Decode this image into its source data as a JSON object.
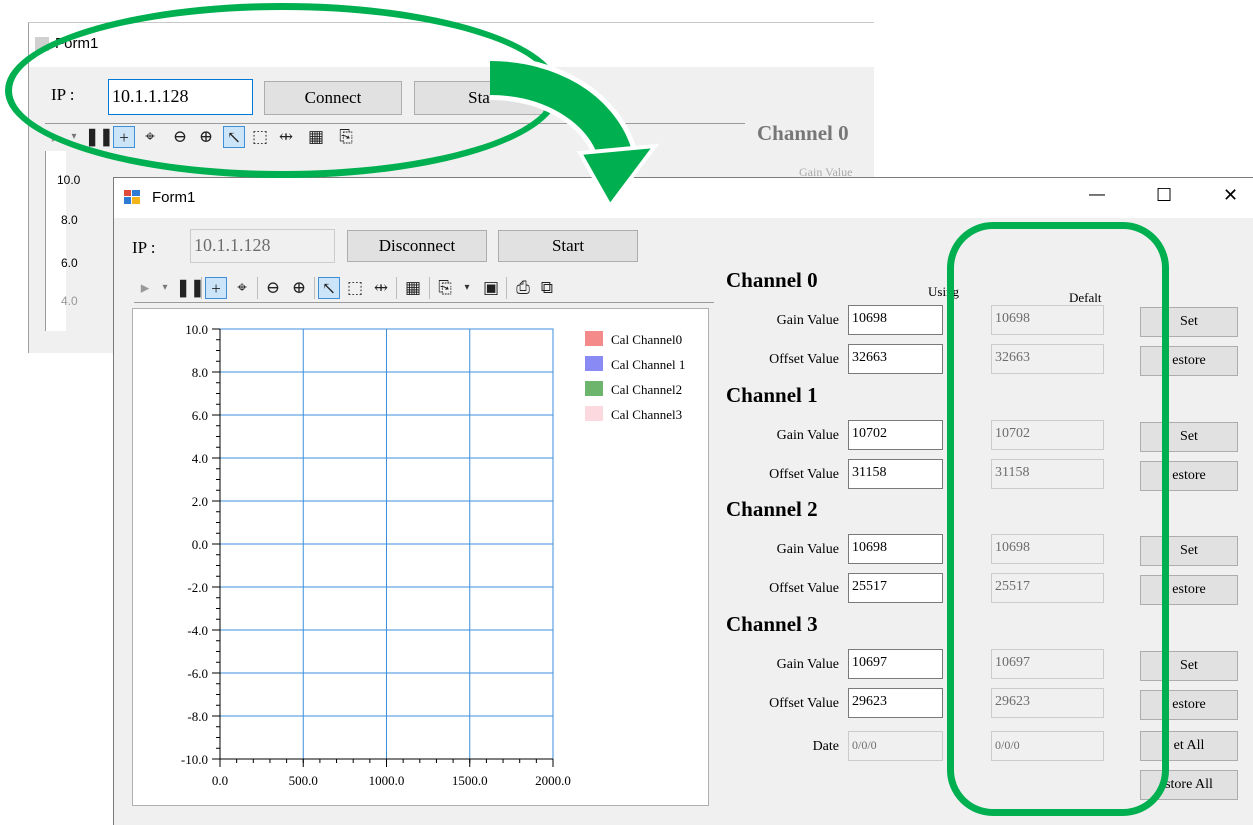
{
  "back_window": {
    "title": "Form1",
    "ip_label": "IP :",
    "ip_value": "10.1.1.128",
    "connect_label": "Connect",
    "start_label_partial": "Sta",
    "channel_title": "Channel 0",
    "gain_label_partial": "Gain Value",
    "y_ticks": [
      "10.0",
      "8.0",
      "6.0",
      "4.0"
    ]
  },
  "window": {
    "title": "Form1",
    "ip_label": "IP :",
    "ip_value": "10.1.1.128",
    "disconnect_label": "Disconnect",
    "start_label": "Start",
    "controls": {
      "minimize": "—",
      "maximize": "☐",
      "close": "✕"
    }
  },
  "chart_data": {
    "type": "line",
    "xlim": [
      0,
      2000
    ],
    "ylim": [
      -10,
      10
    ],
    "x_ticks": [
      "0.0",
      "500.0",
      "1000.0",
      "1500.0",
      "2000.0"
    ],
    "y_ticks": [
      "10.0",
      "8.0",
      "6.0",
      "4.0",
      "2.0",
      "0.0",
      "-2.0",
      "-4.0",
      "-6.0",
      "-8.0",
      "-10.0"
    ],
    "grid": true,
    "legend_position": "top-right",
    "series": [
      {
        "name": "Cal Channel0",
        "color": "#f48a8a",
        "values": []
      },
      {
        "name": "Cal Channel 1",
        "color": "#8a8af4",
        "values": []
      },
      {
        "name": "Cal Channel2",
        "color": "#6db56d",
        "values": []
      },
      {
        "name": "Cal Channel3",
        "color": "#fcd9df",
        "values": []
      }
    ]
  },
  "panel": {
    "using_header": "Using",
    "default_header": "Defalt",
    "channels": [
      {
        "title": "Channel 0",
        "gain_label": "Gain Value",
        "gain_using": "10698",
        "gain_default": "10698",
        "offset_label": "Offset Value",
        "offset_using": "32663",
        "offset_default": "32663",
        "set_label": "Set",
        "restore_label": "estore"
      },
      {
        "title": "Channel 1",
        "gain_label": "Gain Value",
        "gain_using": "10702",
        "gain_default": "10702",
        "offset_label": "Offset Value",
        "offset_using": "31158",
        "offset_default": "31158",
        "set_label": "Set",
        "restore_label": "estore"
      },
      {
        "title": "Channel 2",
        "gain_label": "Gain Value",
        "gain_using": "10698",
        "gain_default": "10698",
        "offset_label": "Offset Value",
        "offset_using": "25517",
        "offset_default": "25517",
        "set_label": "Set",
        "restore_label": "estore"
      },
      {
        "title": "Channel 3",
        "gain_label": "Gain Value",
        "gain_using": "10697",
        "gain_default": "10697",
        "offset_label": "Offset Value",
        "offset_using": "29623",
        "offset_default": "29623",
        "set_label": "Set",
        "restore_label": "estore"
      }
    ],
    "date_label": "Date",
    "date_using": "0/0/0",
    "date_default": "0/0/0",
    "set_all_label": "et All",
    "restore_all_label": "store All"
  },
  "colors": {
    "highlight_green": "#00b050",
    "grid_blue": "#3b8fdc",
    "window_bg": "#f0f0f0"
  },
  "icons": [
    "play-icon",
    "dropdown-icon",
    "pause-icon",
    "move-icon",
    "zoom-fit-icon",
    "zoom-out-icon",
    "zoom-in-icon",
    "pointer-icon",
    "select-rect-icon",
    "cursor-icon",
    "properties-icon",
    "copy-icon",
    "save-icon",
    "print-icon",
    "print-preview-icon"
  ]
}
